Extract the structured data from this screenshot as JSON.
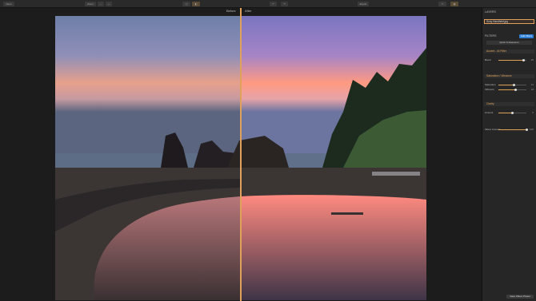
{
  "toolbar": {
    "left_button": "Open",
    "zoom_label": "Zoom",
    "right_label": "Export",
    "settings_label": "Settings"
  },
  "compare": {
    "before": "Before",
    "after": "After"
  },
  "panel": {
    "layers_title": "LAYERS",
    "layer_name": "Sony Handheld.jpg",
    "filters_title": "FILTERS",
    "add_filters": "Add Filters",
    "quick_presets": "Quick & Awesome",
    "filter1": "Accent - AI Filter",
    "boost_label": "Boost",
    "boost_value": "25",
    "filter2": "Saturation / Vibrance",
    "saturation_label": "Saturation",
    "saturation_value": "14",
    "vibrance_label": "Vibrance",
    "vibrance_value": "18",
    "filter3": "Clarity",
    "amount_label": "Amount",
    "amount_value": "0",
    "filters_amount_label": "Filters Amount",
    "filters_amount_value": "100",
    "save_button": "Save Filters Preset",
    "boost_level": 0.9,
    "saturation_level": 0.55,
    "vibrance_level": 0.6,
    "amount_level": 0.5,
    "filters_amount_level": 1.0
  },
  "colors": {
    "accent": "#e0a25a",
    "add_filters_bg": "#2d7fd6"
  }
}
